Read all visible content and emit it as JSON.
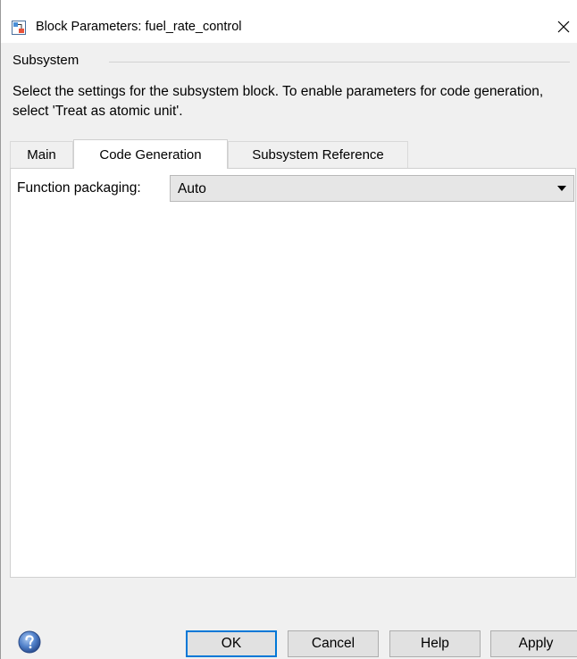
{
  "window": {
    "title": "Block Parameters: fuel_rate_control",
    "title_icon": "simulink-block-icon",
    "close_icon": "close-icon"
  },
  "group": {
    "label": "Subsystem",
    "description": "Select the settings for the subsystem block. To enable parameters for code generation, select 'Treat as atomic unit'."
  },
  "tabs": [
    {
      "label": "Main",
      "active": false
    },
    {
      "label": "Code Generation",
      "active": true
    },
    {
      "label": "Subsystem Reference",
      "active": false
    }
  ],
  "code_generation": {
    "function_packaging_label": "Function packaging:",
    "function_packaging_value": "Auto"
  },
  "buttons": {
    "ok": "OK",
    "cancel": "Cancel",
    "help": "Help",
    "apply": "Apply",
    "help_icon": "help-question-icon"
  },
  "colors": {
    "focus_border": "#0078d7",
    "dialog_background": "#f0f0f0"
  }
}
